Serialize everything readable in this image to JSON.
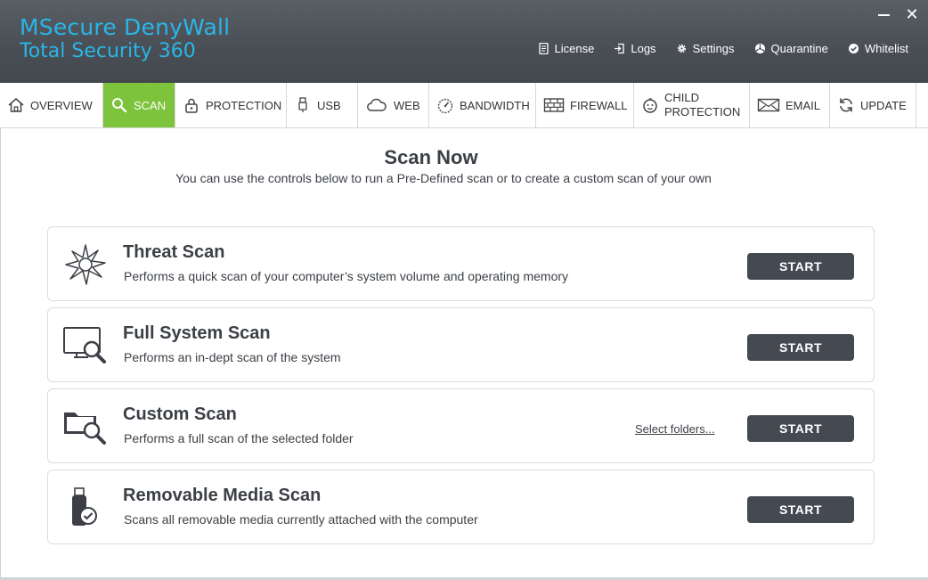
{
  "app": {
    "brand_line1": "MSecure DenyWall",
    "brand_line2": "Total Security 360",
    "accent_color": "#29b6e8",
    "active_tab_color": "#7dc33b",
    "button_color": "#454a52"
  },
  "window_controls": {
    "minimize_icon": "minimize-icon",
    "close_label": "✕"
  },
  "toplinks": [
    {
      "label": "License",
      "icon": "license-icon"
    },
    {
      "label": "Logs",
      "icon": "logs-icon"
    },
    {
      "label": "Settings",
      "icon": "gear-icon"
    },
    {
      "label": "Quarantine",
      "icon": "quarantine-icon"
    },
    {
      "label": "Whitelist",
      "icon": "check-circle-icon"
    }
  ],
  "tabs": [
    {
      "label": "OVERVIEW",
      "icon": "home-icon"
    },
    {
      "label": "SCAN",
      "icon": "search-icon",
      "active": true
    },
    {
      "label": "PROTECTION",
      "icon": "lock-icon"
    },
    {
      "label": "USB",
      "icon": "usb-icon"
    },
    {
      "label": "WEB",
      "icon": "cloud-icon"
    },
    {
      "label": "BANDWIDTH",
      "icon": "gauge-icon"
    },
    {
      "label": "FIREWALL",
      "icon": "brick-wall-icon"
    },
    {
      "label_line1": "CHILD",
      "label_line2": "PROTECTION",
      "icon": "child-face-icon"
    },
    {
      "label": "EMAIL",
      "icon": "envelope-icon"
    },
    {
      "label": "UPDATE",
      "icon": "refresh-icon"
    }
  ],
  "main": {
    "title": "Scan Now",
    "subtitle": "You can use the controls below to run a Pre-Defined scan or to create a custom scan of your own"
  },
  "scans": [
    {
      "title": "Threat Scan",
      "desc": "Performs a quick scan of your computer’s system volume and operating memory",
      "button": "START",
      "icon": "virus-icon"
    },
    {
      "title": "Full System Scan",
      "desc": "Performs an in-dept scan of the system",
      "button": "START",
      "icon": "monitor-search-icon"
    },
    {
      "title": "Custom Scan",
      "desc": "Performs a full scan of the selected folder",
      "button": "START",
      "link": "Select folders...",
      "icon": "folder-search-icon"
    },
    {
      "title": "Removable Media Scan",
      "desc": "Scans all removable media currently attached with the computer",
      "button": "START",
      "icon": "usb-drive-check-icon"
    }
  ]
}
